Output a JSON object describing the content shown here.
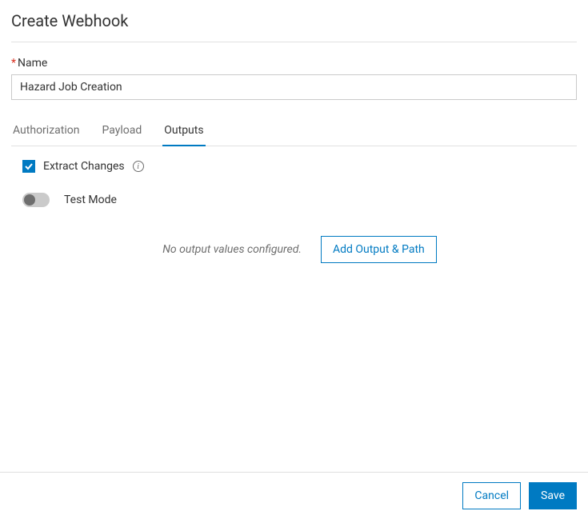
{
  "header": {
    "title": "Create Webhook"
  },
  "name_field": {
    "label": "Name",
    "required_marker": "*",
    "value": "Hazard Job Creation"
  },
  "tabs": [
    {
      "label": "Authorization",
      "active": false
    },
    {
      "label": "Payload",
      "active": false
    },
    {
      "label": "Outputs",
      "active": true
    }
  ],
  "outputs": {
    "extract_changes": {
      "label": "Extract Changes",
      "checked": true
    },
    "test_mode": {
      "label": "Test Mode",
      "enabled": false
    },
    "empty_message": "No output values configured.",
    "add_button": "Add Output & Path"
  },
  "footer": {
    "cancel": "Cancel",
    "save": "Save"
  }
}
